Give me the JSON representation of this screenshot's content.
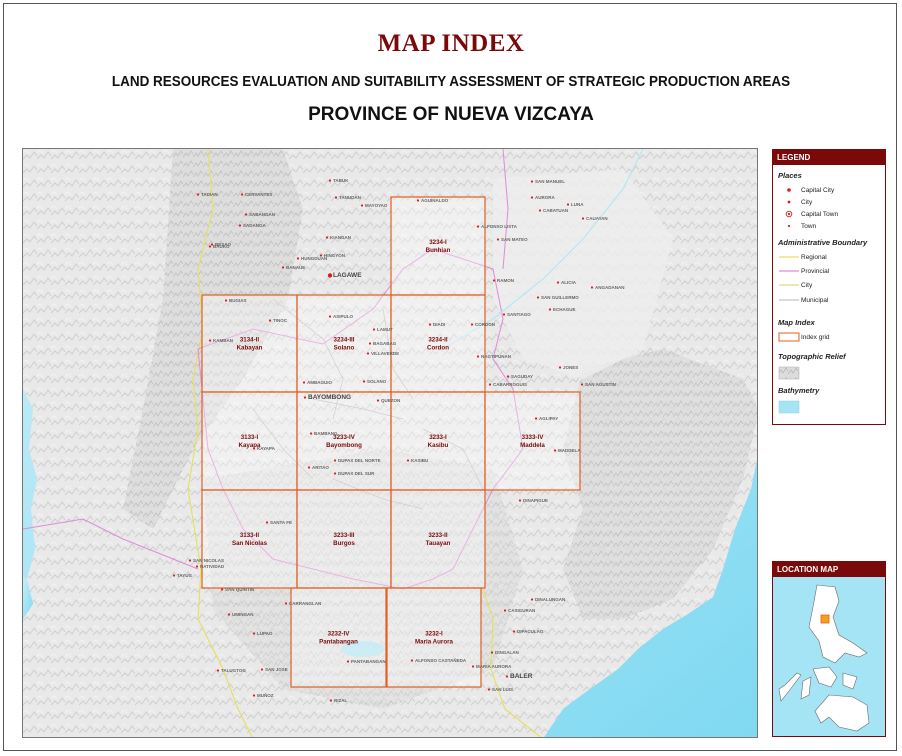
{
  "header": {
    "title": "MAP INDEX",
    "subtitle": "LAND RESOURCES EVALUATION AND SUITABILITY ASSESSMENT OF STRATEGIC PRODUCTION AREAS",
    "province": "PROVINCE OF NUEVA VIZCAYA"
  },
  "colors": {
    "title": "#7a0a0a",
    "panel_header": "#7a0a0a",
    "index_grid": "#e06020",
    "regional_boundary": "#e6e05a",
    "provincial_boundary": "#e08ad8",
    "municipal_boundary": "#b5b5b5",
    "water": "#a5e4f4",
    "place_marker": "#d81e1e"
  },
  "legend": {
    "header": "LEGEND",
    "places_heading": "Places",
    "places": [
      "Capital City",
      "City",
      "Capital Town",
      "Town"
    ],
    "boundary_heading": "Administrative Boundary",
    "boundaries": [
      "Regional",
      "Provincial",
      "City",
      "Municipal"
    ],
    "map_index_heading": "Map Index",
    "index_grid_label": "Index grid",
    "relief_heading": "Topographic Relief",
    "bathymetry_heading": "Bathymetry"
  },
  "location_map": {
    "header": "LOCATION MAP"
  },
  "index_grid": [
    {
      "code": "3234-I",
      "name": "Bunhian"
    },
    {
      "code": "3134-II",
      "name": "Kabayan"
    },
    {
      "code": "3234-III",
      "name": "Solano"
    },
    {
      "code": "3234-II",
      "name": "Cordon"
    },
    {
      "code": "3133-I",
      "name": "Kayapa"
    },
    {
      "code": "3233-IV",
      "name": "Bayombong"
    },
    {
      "code": "3233-I",
      "name": "Kasibu"
    },
    {
      "code": "3333-IV",
      "name": "Maddela"
    },
    {
      "code": "3133-II",
      "name": "San Nicolas"
    },
    {
      "code": "3233-III",
      "name": "Burgos"
    },
    {
      "code": "3233-II",
      "name": "Tauayan"
    },
    {
      "code": "3232-IV",
      "name": "Pantabangan"
    },
    {
      "code": "3232-I",
      "name": "Maria Aurora"
    }
  ],
  "places": [
    "LAGAWE",
    "BAYOMBONG",
    "QUEZON",
    "AGUINALDO",
    "ALFONSO LISTA",
    "SAN MATEO",
    "CAUAYAN",
    "LUNA",
    "SAN MANUEL",
    "AURORA",
    "CABATUAN",
    "RAMON",
    "ALICIA",
    "ANGADANAN",
    "SAN GUILLERMO",
    "ECHAGUE",
    "SANTIAGO",
    "CORDON",
    "DIADI",
    "NAGTIPUNAN",
    "SAGUDAY",
    "JONES",
    "SAN AGUSTIN",
    "CABARROGUIS",
    "AGLIPAY",
    "MADDELA",
    "DINAPIGUE",
    "DINALUNGAN",
    "CASIGURAN",
    "DIPACULAO",
    "BALER",
    "MARIA AURORA",
    "SAN LUIS",
    "DINGALAN",
    "BUGIAS",
    "TINOC",
    "KAMBAN",
    "ASIPULO",
    "LAMUT",
    "BAGABAG",
    "VILLAVERDE",
    "AMBAGUIO",
    "SOLANO",
    "BAMBANG",
    "DUPAX DEL NORTE",
    "DUPAX DEL SUR",
    "ARITAO",
    "KASIBU",
    "KAYAPA",
    "SANTA FE",
    "SAN NICOLAS",
    "NATIVIDAD",
    "TAYUG",
    "SAN QUINTIN",
    "UMINGAN",
    "CARRANGLAN",
    "LUPAO",
    "PANTABANGAN",
    "SAN JOSE",
    "TALUGTOG",
    "MUÑOZ",
    "RIZAL",
    "ALFONSO CASTAÑEDA",
    "KIANGAN",
    "HINGYON",
    "BANAUE",
    "MAYOYAO",
    "HUNGDUAN",
    "TABUK",
    "TANUDAN",
    "SABANGAN",
    "SADANGA",
    "BAUKO",
    "TADIAN",
    "BESAO",
    "CERVANTES",
    "MANKAYAN",
    "BUGUIAS"
  ]
}
